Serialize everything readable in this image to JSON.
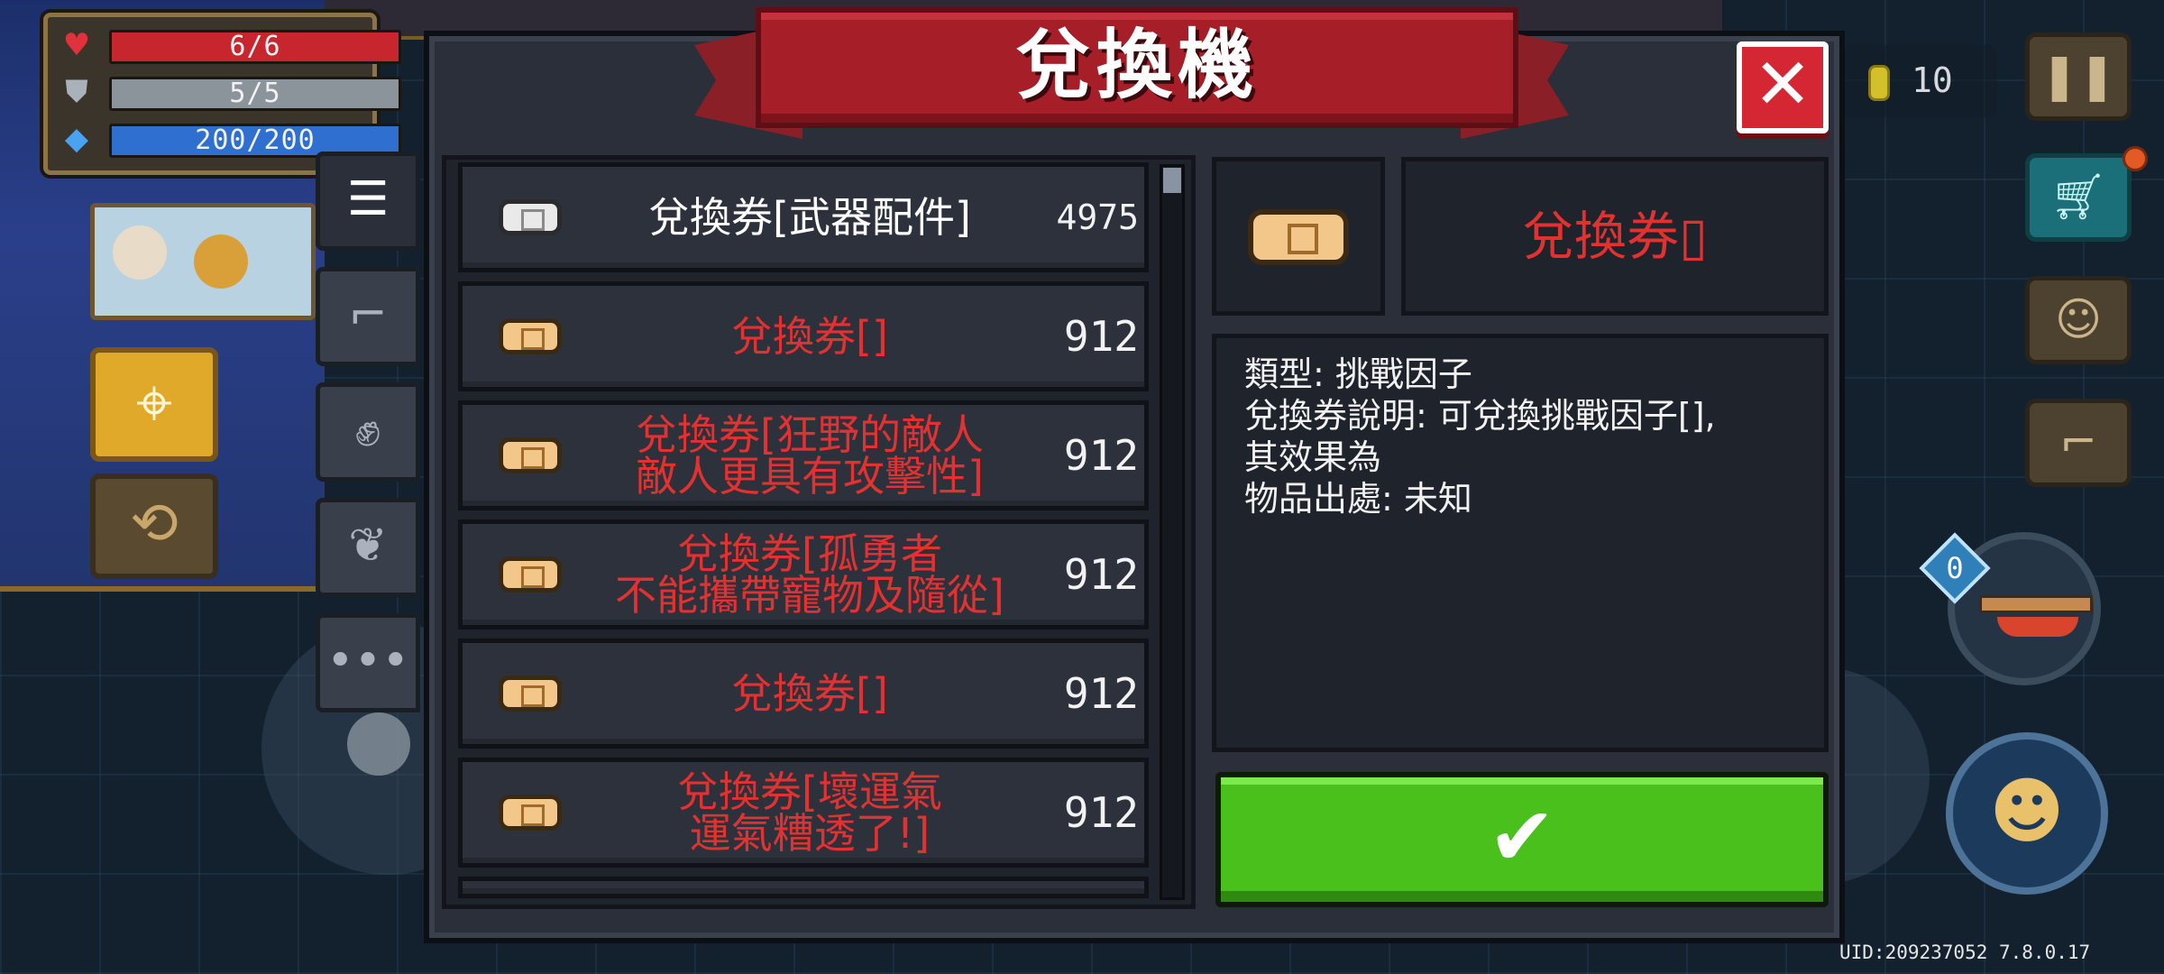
{
  "stats": {
    "hp": "6/6",
    "armor": "5/5",
    "energy": "200/200"
  },
  "hud": {
    "coins": "10",
    "uid": "UID:209237052 7.8.0.17"
  },
  "dialog": {
    "title": "兌換機",
    "close_label": "✕",
    "confirm_label": "✔"
  },
  "list": [
    {
      "name": "兌換券[武器配件]",
      "count": "4975",
      "ticket": "white",
      "name_color": "white"
    },
    {
      "name": "兌換券[]",
      "count": "912",
      "ticket": "gold",
      "name_color": "red"
    },
    {
      "name": "兌換券[狂野的敵人\n敵人更具有攻擊性]",
      "count": "912",
      "ticket": "gold",
      "name_color": "red"
    },
    {
      "name": "兌換券[孤勇者\n不能攜帶寵物及隨從]",
      "count": "912",
      "ticket": "gold",
      "name_color": "red"
    },
    {
      "name": "兌換券[]",
      "count": "912",
      "ticket": "gold",
      "name_color": "red"
    },
    {
      "name": "兌換券[壞運氣\n運氣糟透了!]",
      "count": "912",
      "ticket": "gold",
      "name_color": "red"
    }
  ],
  "detail": {
    "title": "兌換券▯",
    "lines": [
      "類型: 挑戰因子",
      "兌換券說明: 可兌換挑戰因子[],",
      "其效果為",
      "物品出處: 未知"
    ]
  },
  "colors": {
    "accent_red": "#e23131",
    "confirm_green": "#49c01c",
    "ribbon_red": "#a51e28",
    "hp_red": "#c8262e",
    "armor_gray": "#8b939b",
    "energy_blue": "#2f6fd0"
  },
  "icons": {
    "hp": "heart-icon",
    "armor": "shield-icon",
    "energy": "diamond-icon",
    "tab_list": "list-icon",
    "tab_weapon": "gun-icon",
    "tab_skill": "fist-icon",
    "tab_plant": "plant-icon",
    "tab_more": "ellipsis-icon",
    "pause": "pause-icon",
    "shop": "cart-icon",
    "profile": "profile-card-icon",
    "stairs": "stairs-icon"
  }
}
